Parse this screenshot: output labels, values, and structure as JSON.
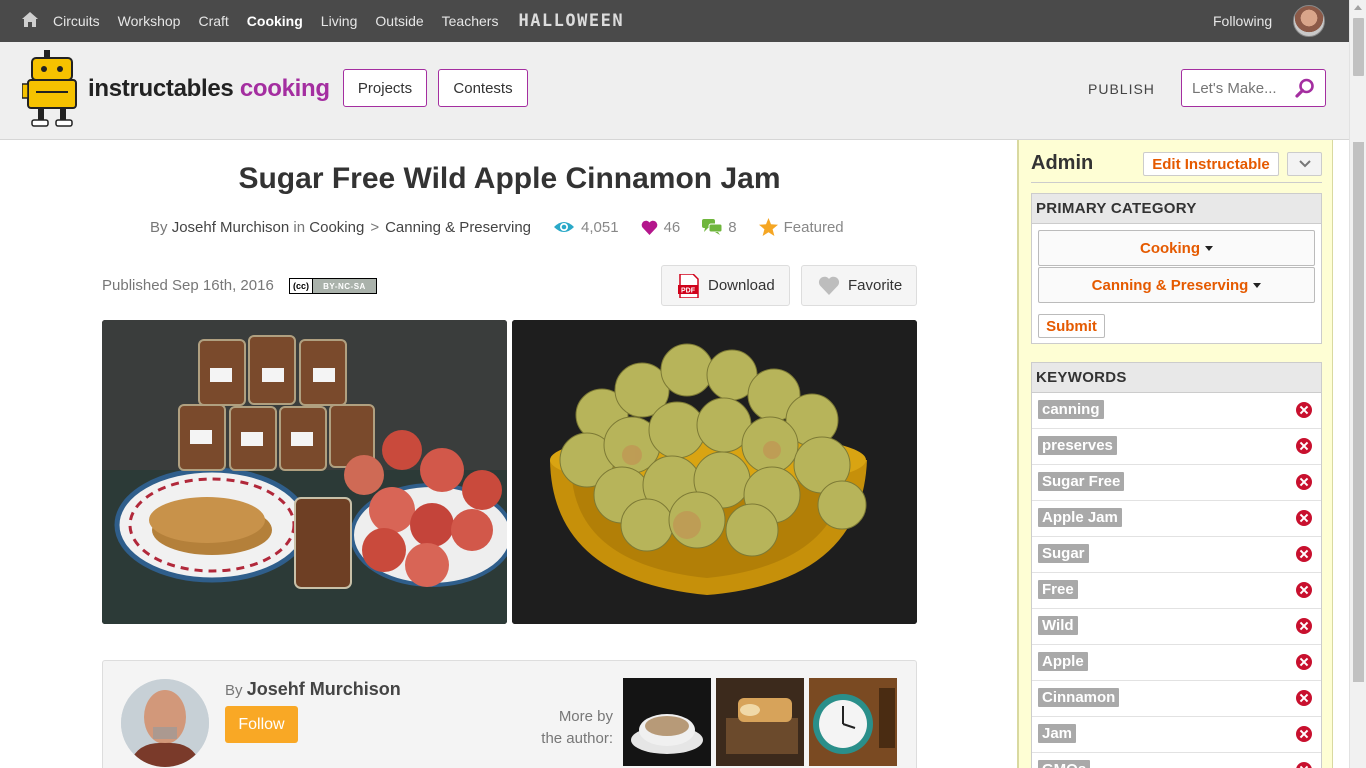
{
  "topnav": {
    "categories": [
      "Circuits",
      "Workshop",
      "Craft",
      "Cooking",
      "Living",
      "Outside",
      "Teachers"
    ],
    "active": "Cooking",
    "halloween": "HALLOWEEN",
    "following": "Following"
  },
  "header": {
    "logo_main": "instructables",
    "logo_accent": "cooking",
    "projects_label": "Projects",
    "contests_label": "Contests",
    "publish_label": "PUBLISH",
    "search_placeholder": "Let's Make..."
  },
  "article": {
    "title": "Sugar Free Wild Apple Cinnamon Jam",
    "by": "By",
    "author": "Josehf Murchison",
    "in": "in",
    "category": "Cooking",
    "separator": ">",
    "subcategory": "Canning & Preserving",
    "views": "4,051",
    "favorites": "46",
    "comments": "8",
    "featured": "Featured",
    "published": "Published Sep 16th, 2016",
    "license_cc": "(cc)",
    "license_terms": "BY-NC-SA",
    "download_label": "Download",
    "favorite_label": "Favorite"
  },
  "author_box": {
    "by": "By",
    "name": "Josehf Murchison",
    "follow_label": "Follow",
    "more_by_line1": "More by",
    "more_by_line2": "the author:"
  },
  "admin": {
    "title": "Admin",
    "edit_label": "Edit Instructable",
    "primary_category_header": "PRIMARY CATEGORY",
    "category": "Cooking",
    "subcategory": "Canning & Preserving",
    "submit_label": "Submit",
    "keywords_header": "KEYWORDS",
    "keywords": [
      "canning",
      "preserves",
      "Sugar Free",
      "Apple Jam",
      "Sugar",
      "Free",
      "Wild",
      "Apple",
      "Cinnamon",
      "Jam",
      "GMOs"
    ]
  },
  "colors": {
    "accent": "#a42ea0",
    "admin_action": "#e55a00",
    "follow": "#f9a825",
    "delete": "#c8102e"
  }
}
